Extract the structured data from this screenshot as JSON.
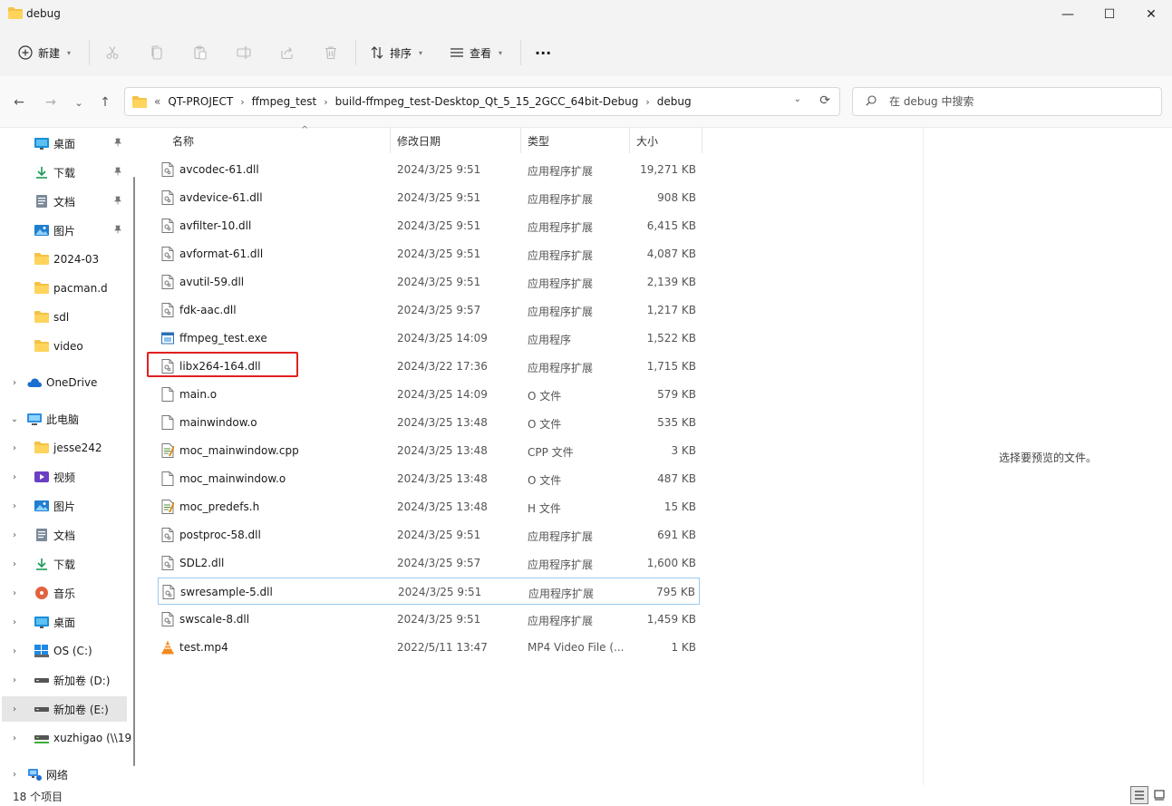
{
  "window": {
    "title": "debug",
    "controls": {
      "minimize": "—",
      "maximize": "☐",
      "close": "✕"
    }
  },
  "toolbar": {
    "new_label": "新建",
    "sort_label": "排序",
    "view_label": "查看",
    "more_label": "···"
  },
  "nav": {
    "back": "←",
    "forward": "→",
    "recent": "⌄",
    "up": "↑",
    "refresh": "⟳",
    "dropdown": "⌄"
  },
  "address": {
    "overflow": "«",
    "crumbs": [
      "QT-PROJECT",
      "ffmpeg_test",
      "build-ffmpeg_test-Desktop_Qt_5_15_2GCC_64bit-Debug",
      "debug"
    ],
    "separator": "›"
  },
  "search": {
    "placeholder": "在 debug 中搜索"
  },
  "sidebar": {
    "items": [
      {
        "label": "桌面",
        "icon": "desktop-icon",
        "pinned": true
      },
      {
        "label": "下载",
        "icon": "download-icon",
        "pinned": true
      },
      {
        "label": "文档",
        "icon": "document-icon",
        "pinned": true
      },
      {
        "label": "图片",
        "icon": "picture-icon",
        "pinned": true
      },
      {
        "label": "2024-03",
        "icon": "folder-icon"
      },
      {
        "label": "pacman.d",
        "icon": "folder-icon"
      },
      {
        "label": "sdl",
        "icon": "folder-icon"
      },
      {
        "label": "video",
        "icon": "folder-icon"
      },
      {
        "label": "OneDrive",
        "icon": "cloud-icon",
        "expand": "›"
      },
      {
        "label": "此电脑",
        "icon": "computer-icon",
        "expand": "⌄"
      },
      {
        "label": "jesse242",
        "icon": "folder-icon",
        "expand": "›"
      },
      {
        "label": "视频",
        "icon": "video-icon",
        "expand": "›"
      },
      {
        "label": "图片",
        "icon": "picture-icon",
        "expand": "›"
      },
      {
        "label": "文档",
        "icon": "document-icon",
        "expand": "›"
      },
      {
        "label": "下载",
        "icon": "download-icon",
        "expand": "›"
      },
      {
        "label": "音乐",
        "icon": "music-icon",
        "expand": "›"
      },
      {
        "label": "桌面",
        "icon": "desktop-icon",
        "expand": "›"
      },
      {
        "label": "OS (C:)",
        "icon": "windows-drive-icon",
        "expand": "›"
      },
      {
        "label": "新加卷 (D:)",
        "icon": "drive-icon",
        "expand": "›"
      },
      {
        "label": "新加卷 (E:)",
        "icon": "drive-icon",
        "expand": "›",
        "selected": true
      },
      {
        "label": "xuzhigao (\\\\19",
        "icon": "network-drive-icon",
        "expand": "›"
      },
      {
        "label": "网络",
        "icon": "network-icon",
        "expand": "›"
      }
    ],
    "pin_glyph": "📌"
  },
  "columns": {
    "name": "名称",
    "modified": "修改日期",
    "type": "类型",
    "size": "大小",
    "sort_indicator": "^"
  },
  "files": [
    {
      "name": "avcodec-61.dll",
      "modified": "2024/3/25 9:51",
      "type": "应用程序扩展",
      "size": "19,271 KB",
      "icon": "dll-icon"
    },
    {
      "name": "avdevice-61.dll",
      "modified": "2024/3/25 9:51",
      "type": "应用程序扩展",
      "size": "908 KB",
      "icon": "dll-icon"
    },
    {
      "name": "avfilter-10.dll",
      "modified": "2024/3/25 9:51",
      "type": "应用程序扩展",
      "size": "6,415 KB",
      "icon": "dll-icon"
    },
    {
      "name": "avformat-61.dll",
      "modified": "2024/3/25 9:51",
      "type": "应用程序扩展",
      "size": "4,087 KB",
      "icon": "dll-icon"
    },
    {
      "name": "avutil-59.dll",
      "modified": "2024/3/25 9:51",
      "type": "应用程序扩展",
      "size": "2,139 KB",
      "icon": "dll-icon"
    },
    {
      "name": "fdk-aac.dll",
      "modified": "2024/3/25 9:57",
      "type": "应用程序扩展",
      "size": "1,217 KB",
      "icon": "dll-icon"
    },
    {
      "name": "ffmpeg_test.exe",
      "modified": "2024/3/25 14:09",
      "type": "应用程序",
      "size": "1,522 KB",
      "icon": "exe-icon"
    },
    {
      "name": "libx264-164.dll",
      "modified": "2024/3/22 17:36",
      "type": "应用程序扩展",
      "size": "1,715 KB",
      "icon": "dll-icon"
    },
    {
      "name": "main.o",
      "modified": "2024/3/25 14:09",
      "type": "O 文件",
      "size": "579 KB",
      "icon": "file-icon"
    },
    {
      "name": "mainwindow.o",
      "modified": "2024/3/25 13:48",
      "type": "O 文件",
      "size": "535 KB",
      "icon": "file-icon"
    },
    {
      "name": "moc_mainwindow.cpp",
      "modified": "2024/3/25 13:48",
      "type": "CPP 文件",
      "size": "3 KB",
      "icon": "source-file-icon"
    },
    {
      "name": "moc_mainwindow.o",
      "modified": "2024/3/25 13:48",
      "type": "O 文件",
      "size": "487 KB",
      "icon": "file-icon"
    },
    {
      "name": "moc_predefs.h",
      "modified": "2024/3/25 13:48",
      "type": "H 文件",
      "size": "15 KB",
      "icon": "source-file-icon"
    },
    {
      "name": "postproc-58.dll",
      "modified": "2024/3/25 9:51",
      "type": "应用程序扩展",
      "size": "691 KB",
      "icon": "dll-icon"
    },
    {
      "name": "SDL2.dll",
      "modified": "2024/3/25 9:57",
      "type": "应用程序扩展",
      "size": "1,600 KB",
      "icon": "dll-icon"
    },
    {
      "name": "swresample-5.dll",
      "modified": "2024/3/25 9:51",
      "type": "应用程序扩展",
      "size": "795 KB",
      "icon": "dll-icon",
      "focused": true
    },
    {
      "name": "swscale-8.dll",
      "modified": "2024/3/25 9:51",
      "type": "应用程序扩展",
      "size": "1,459 KB",
      "icon": "dll-icon"
    },
    {
      "name": "test.mp4",
      "modified": "2022/5/11 13:47",
      "type": "MP4 Video File (...",
      "size": "1 KB",
      "icon": "vlc-icon"
    }
  ],
  "preview": {
    "message": "选择要预览的文件。"
  },
  "status": {
    "item_count": "18 个项目"
  },
  "colors": {
    "folder": "#f4c245",
    "highlight_box": "#e02020",
    "focus_border": "#99c9ef",
    "selected_bg": "#e6e6e6"
  }
}
